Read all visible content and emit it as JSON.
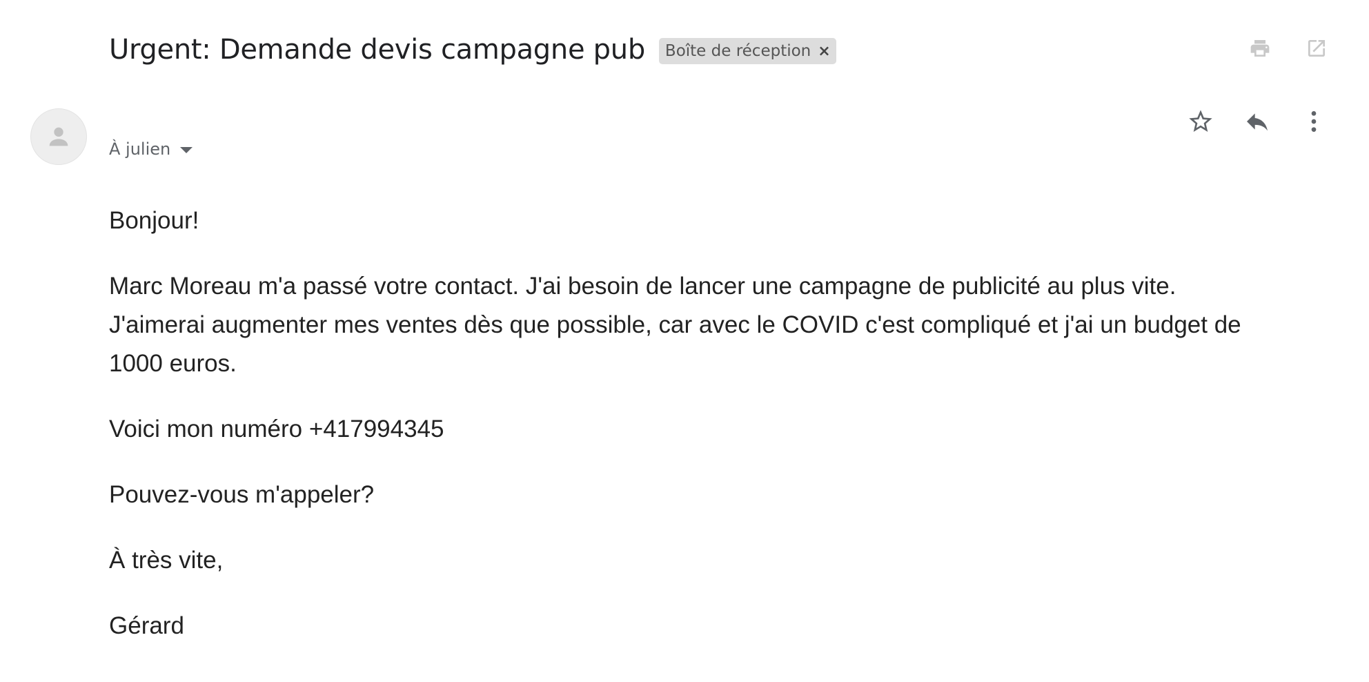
{
  "email": {
    "subject": "Urgent: Demande devis campagne pub",
    "label": {
      "text": "Boîte de réception",
      "close_glyph": "×"
    },
    "top_icons": [
      "print-icon",
      "open-in-new-window-icon"
    ],
    "recipient": "À julien",
    "actions": [
      "star-icon",
      "reply-icon",
      "more-options-icon"
    ],
    "body": {
      "greeting": "Bonjour!",
      "paragraph_1": "Marc Moreau m'a passé votre contact. J'ai besoin de lancer une campagne de publicité au plus vite. J'aimerai augmenter mes ventes dès que possible, car avec le COVID c'est compliqué et j'ai un budget de 1000 euros.",
      "paragraph_2": "Voici mon numéro +417994345",
      "paragraph_3": "Pouvez-vous m'appeler?",
      "closing": "À très vite,",
      "signature": "Gérard"
    }
  },
  "colors": {
    "text": "#202124",
    "muted": "#5f6368",
    "chip_bg": "#dddddd",
    "icon_light": "#c8c8c8"
  }
}
